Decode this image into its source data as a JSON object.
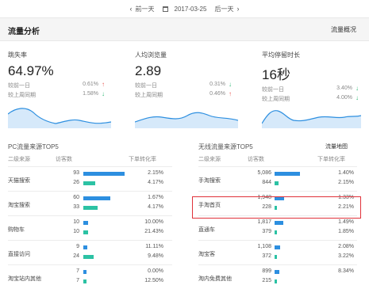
{
  "datebar": {
    "prev": "前一天",
    "date": "2017-03-25",
    "next": "后一天"
  },
  "header": {
    "title": "流量分析",
    "link": "流量概况"
  },
  "metrics": [
    {
      "label": "跳失率",
      "value": "64.97%",
      "r1_label": "较前一日",
      "r1_pct": "0.61%",
      "r1_dir": "up",
      "r2_label": "较上周同期",
      "r2_pct": "1.58%",
      "r2_dir": "down"
    },
    {
      "label": "人均浏览量",
      "value": "2.89",
      "r1_label": "较前一日",
      "r1_pct": "0.31%",
      "r1_dir": "down",
      "r2_label": "较上周同期",
      "r2_pct": "0.46%",
      "r2_dir": "up"
    },
    {
      "label": "平均停留时长",
      "value": "16秒",
      "r1_label": "较前一日",
      "r1_pct": "3.40%",
      "r1_dir": "down",
      "r2_label": "较上周同期",
      "r2_pct": "4.00%",
      "r2_dir": "down"
    }
  ],
  "pc": {
    "title": "PC流量来源TOP5",
    "headers": {
      "source": "二级来源",
      "visitors": "访客数",
      "rate": "下单转化率"
    },
    "rows": [
      {
        "source": "天猫搜索",
        "v1": 93,
        "v2": 26,
        "r1": "2.15%",
        "r2": "4.17%"
      },
      {
        "source": "淘宝搜索",
        "v1": 60,
        "v2": 33,
        "r1": "1.67%",
        "r2": "4.17%"
      },
      {
        "source": "购物车",
        "v1": 10,
        "v2": 10,
        "r1": "10.00%",
        "r2": "21.43%"
      },
      {
        "source": "直接访问",
        "v1": 9,
        "v2": 24,
        "r1": "11.11%",
        "r2": "9.48%"
      },
      {
        "source": "淘宝站内其他",
        "v1": 7,
        "v2": 7,
        "r1": "0.00%",
        "r2": "12.50%"
      }
    ]
  },
  "mobile": {
    "title": "无线流量来源TOP5",
    "link": "流量地图",
    "headers": {
      "source": "二级来源",
      "visitors": "访客数",
      "rate": "下单转化率"
    },
    "rows": [
      {
        "source": "手淘搜索",
        "v1": "5,086",
        "v2": 844,
        "r1": "1.40%",
        "r2": "2.15%"
      },
      {
        "source": "手淘首页",
        "v1": "1,948",
        "v2": 228,
        "r1": "1.33%",
        "r2": "2.21%"
      },
      {
        "source": "直通车",
        "v1": "1,817",
        "v2": 379,
        "r1": "1.49%",
        "r2": "1.85%"
      },
      {
        "source": "淘宝客",
        "v1": "1,108",
        "v2": 372,
        "r1": "2.08%",
        "r2": "3.22%"
      },
      {
        "source": "淘内免费其他",
        "v1": 899,
        "v2": 215,
        "r1": "8.34%",
        "r2": ""
      }
    ]
  },
  "colors": {
    "blue_bar": "#2d8fe0",
    "green_bar": "#2cc2a4",
    "up": "#e8544e",
    "down": "#2bb673",
    "highlight": "#e0323a"
  }
}
